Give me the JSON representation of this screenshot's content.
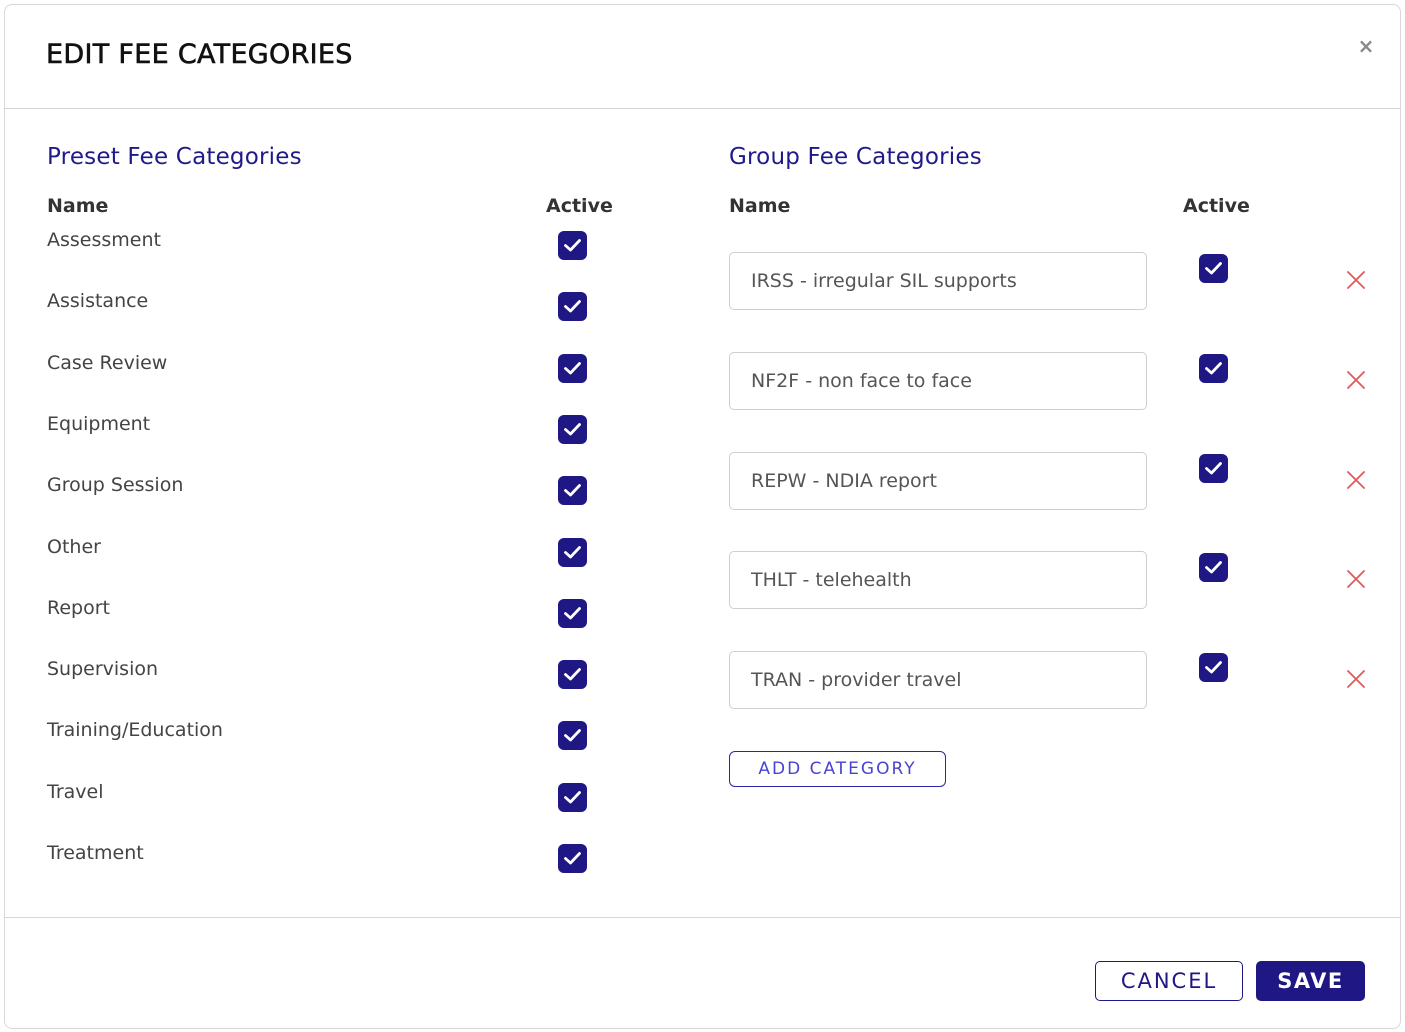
{
  "modal": {
    "title": "EDIT FEE CATEGORIES",
    "close_label": "×"
  },
  "preset": {
    "section_title": "Preset Fee Categories",
    "col_name": "Name",
    "col_active": "Active",
    "items": [
      {
        "name": "Assessment",
        "active": true
      },
      {
        "name": "Assistance",
        "active": true
      },
      {
        "name": "Case Review",
        "active": true
      },
      {
        "name": "Equipment",
        "active": true
      },
      {
        "name": "Group Session",
        "active": true
      },
      {
        "name": "Other",
        "active": true
      },
      {
        "name": "Report",
        "active": true
      },
      {
        "name": "Supervision",
        "active": true
      },
      {
        "name": "Training/Education",
        "active": true
      },
      {
        "name": "Travel",
        "active": true
      },
      {
        "name": "Treatment",
        "active": true
      }
    ]
  },
  "group": {
    "section_title": "Group Fee Categories",
    "col_name": "Name",
    "col_active": "Active",
    "items": [
      {
        "name": "IRSS - irregular SIL supports",
        "active": true
      },
      {
        "name": "NF2F - non face to face",
        "active": true
      },
      {
        "name": "REPW - NDIA report",
        "active": true
      },
      {
        "name": "THLT - telehealth",
        "active": true
      },
      {
        "name": "TRAN - provider travel",
        "active": true
      }
    ],
    "add_label": "ADD CATEGORY"
  },
  "footer": {
    "cancel_label": "CANCEL",
    "save_label": "SAVE"
  },
  "colors": {
    "primary": "#1e1784",
    "section_title": "#1f1a8a",
    "remove_icon": "#e05a5a"
  },
  "icons": {
    "close": "close-icon",
    "check": "checkmark-icon",
    "remove": "remove-x-icon"
  }
}
